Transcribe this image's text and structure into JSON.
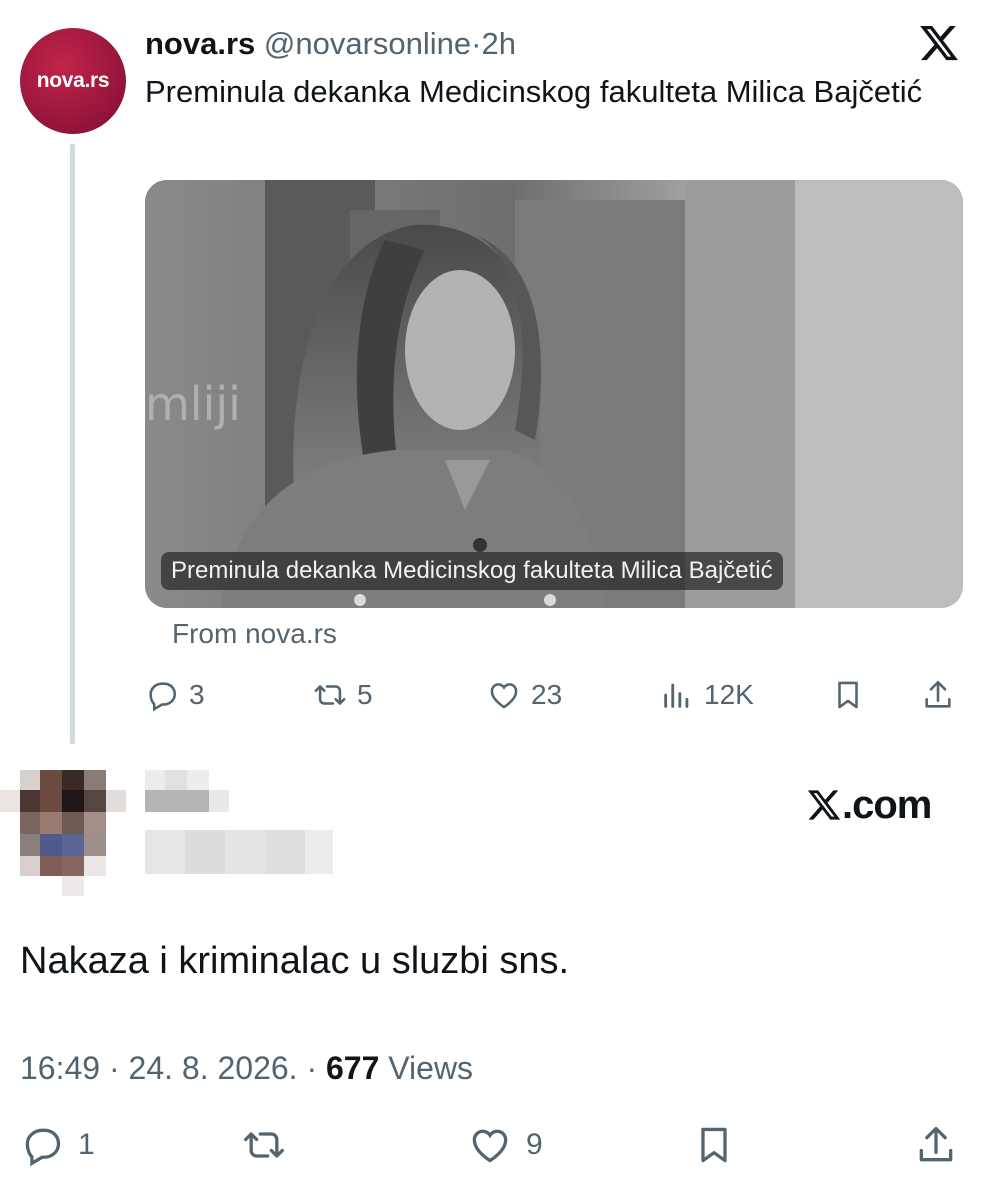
{
  "tweet": {
    "avatar_text": "nova.rs",
    "author_name": "nova.rs",
    "handle": "@novarsonline",
    "separator": "·",
    "time": "2h",
    "text": "Preminula dekanka Medicinskog fakulteta Milica Bajčetić",
    "media_caption": "Preminula dekanka Medicinskog fakulteta Milica Bajčetić",
    "source": "From nova.rs",
    "actions": {
      "replies": "3",
      "retweets": "5",
      "likes": "23",
      "views": "12K"
    },
    "icons": [
      "x-logo-icon",
      "reply-icon",
      "retweet-icon",
      "like-icon",
      "views-icon",
      "bookmark-icon",
      "share-icon"
    ]
  },
  "reply": {
    "text": "Nakaza i kriminalac u sluzbi sns.",
    "time": "16:49",
    "date": "24. 8. 2026.",
    "dot": "·",
    "views_count": "677",
    "views_label": "Views",
    "actions": {
      "replies": "1",
      "likes": "9"
    }
  },
  "watermark": {
    "text": ".com"
  },
  "colors": {
    "avatar": "#a31a40",
    "text": "#0f1419",
    "muted": "#536471",
    "thread_line": "#cfd9de"
  }
}
